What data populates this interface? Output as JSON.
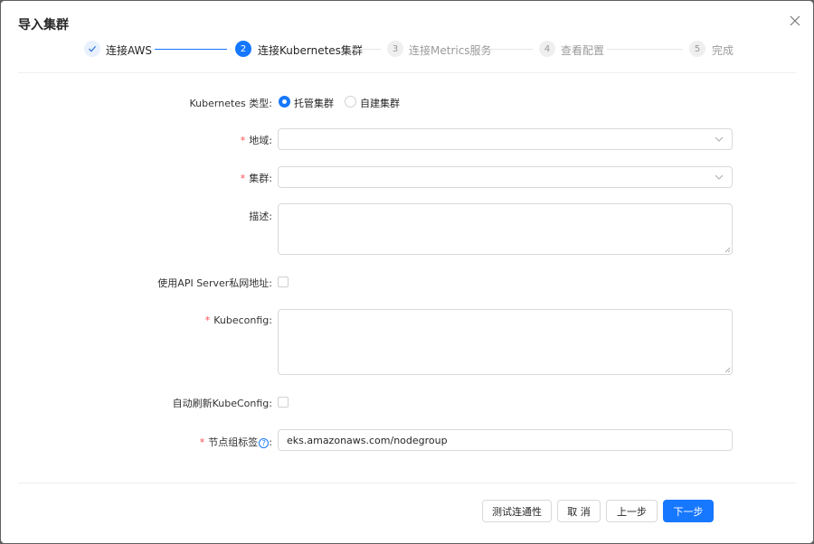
{
  "dialog": {
    "title": "导入集群",
    "close_icon": "close-icon"
  },
  "steps": [
    {
      "label": "连接AWS",
      "status": "done",
      "icon": "check-icon"
    },
    {
      "number": "2",
      "label": "连接Kubernetes集群",
      "status": "active"
    },
    {
      "number": "3",
      "label": "连接Metrics服务",
      "status": "wait"
    },
    {
      "number": "4",
      "label": "查看配置",
      "status": "wait"
    },
    {
      "number": "5",
      "label": "完成",
      "status": "wait"
    }
  ],
  "form": {
    "k8s_type": {
      "label": "Kubernetes 类型",
      "options": [
        "托管集群",
        "自建集群"
      ],
      "selected": "托管集群"
    },
    "region": {
      "label": "地域",
      "required": true,
      "value": ""
    },
    "cluster": {
      "label": "集群",
      "required": true,
      "value": ""
    },
    "description": {
      "label": "描述",
      "value": ""
    },
    "private_endpoint": {
      "label": "使用API Server私网地址",
      "checked": false
    },
    "kubeconfig": {
      "label": "Kubeconfig",
      "required": true,
      "value": ""
    },
    "auto_refresh": {
      "label": "自动刷新KubeConfig",
      "checked": false
    },
    "nodegroup_tag": {
      "label": "节点组标签",
      "required": true,
      "value": "eks.amazonaws.com/nodegroup",
      "help_icon": "question-circle-icon"
    },
    "colon": ":"
  },
  "footer": {
    "test_label": "测试连通性",
    "cancel_label": "取 消",
    "prev_label": "上一步",
    "next_label": "下一步"
  },
  "colors": {
    "primary": "#1677ff",
    "required": "#ff4d4f"
  }
}
